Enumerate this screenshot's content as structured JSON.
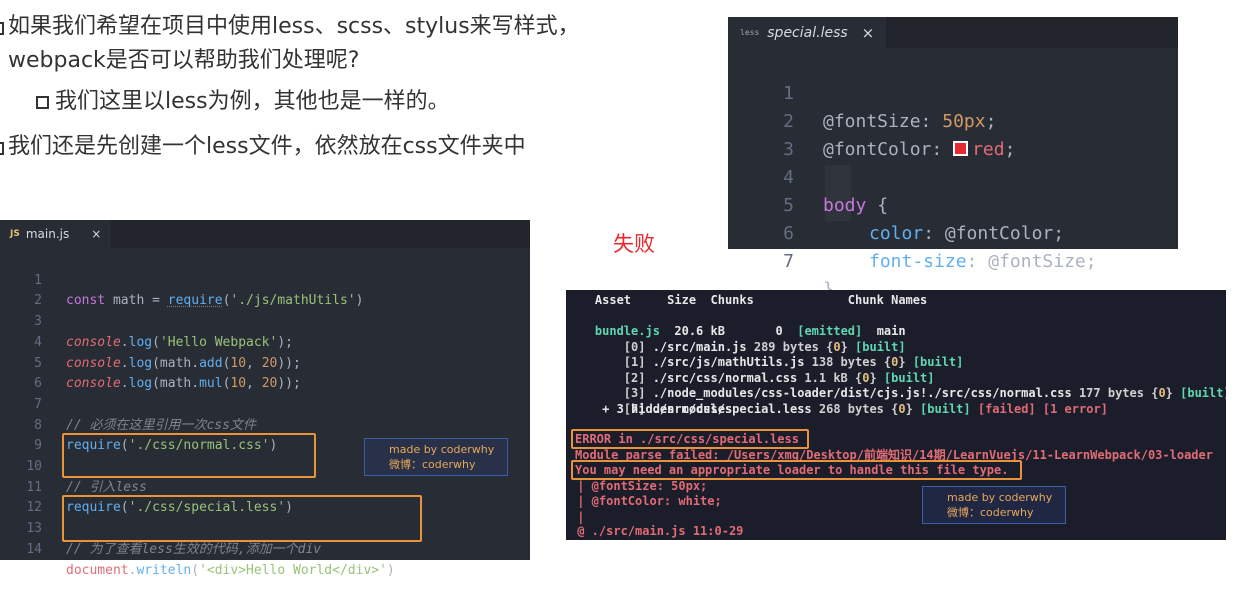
{
  "bullets": {
    "b1_line1": "如果我们希望在项目中使用less、scss、stylus来写样式，",
    "b1_line2": "webpack是否可以帮助我们处理呢?",
    "b2": "我们这里以less为例，其他也是一样的。",
    "b3": "我们还是先创建一个less文件，依然放在css文件夹中"
  },
  "fail_label": "失败",
  "colors": {
    "accent_red": "#e8292d",
    "box_orange": "#e8923a",
    "editor_bg": "#282c34",
    "terminal_bg": "#1c1d2b"
  },
  "less_editor": {
    "tab_icon": "less",
    "tab_label": "special.less",
    "tab_close": "×",
    "lines": [
      {
        "n": "1",
        "p1": "@fontSize",
        "p2": ": ",
        "p3": "50px",
        "p4": ";"
      },
      {
        "n": "2",
        "p1": "@fontColor",
        "p2": ": ",
        "p3": "red",
        "p4": ";"
      },
      {
        "n": "3"
      },
      {
        "n": "4",
        "p1": "body",
        "p2": " {"
      },
      {
        "n": "5",
        "p1": "color",
        "p2": ": ",
        "p3": "@fontColor",
        "p4": ";"
      },
      {
        "n": "6",
        "p1": "font-size",
        "p2": ": ",
        "p3": "@fontSize",
        "p4": ";"
      },
      {
        "n": "7",
        "p1": "}"
      }
    ]
  },
  "js_editor": {
    "tab_icon": "JS",
    "tab_label": "main.js",
    "tab_close": "×",
    "lines": [
      {
        "n": "1",
        "a": "const",
        "b": " math = ",
        "c": "require",
        "d": "(",
        "e": "'./js/mathUtils'",
        "f": ")"
      },
      {
        "n": "2"
      },
      {
        "n": "3",
        "a": "console",
        "b": ".",
        "c": "log",
        "d": "(",
        "e": "'Hello Webpack'",
        "f": ");"
      },
      {
        "n": "4",
        "a": "console",
        "b": ".",
        "c": "log",
        "d": "(math.",
        "e": "add",
        "f": "(",
        "g": "10",
        "h": ", ",
        "i": "20",
        "j": "));"
      },
      {
        "n": "5",
        "a": "console",
        "b": ".",
        "c": "log",
        "d": "(math.",
        "e": "mul",
        "f": "(",
        "g": "10",
        "h": ", ",
        "i": "20",
        "j": "));"
      },
      {
        "n": "6"
      },
      {
        "n": "7",
        "a": "// 必须在这里引用一次css文件"
      },
      {
        "n": "8",
        "a": "require",
        "b": "(",
        "c": "'./css/normal.css'",
        "d": ")"
      },
      {
        "n": "9"
      },
      {
        "n": "10",
        "a": "// 引入less"
      },
      {
        "n": "11",
        "a": "require",
        "b": "(",
        "c": "'./css/special.less'",
        "d": ")"
      },
      {
        "n": "12"
      },
      {
        "n": "13",
        "a": "// 为了查看less生效的代码,添加一个div"
      },
      {
        "n": "14",
        "a": "document",
        "b": ".",
        "c": "writeln",
        "d": "(",
        "e": "'<div>Hello World</div>'",
        "f": ")"
      }
    ]
  },
  "watermark": {
    "line1": "made by coderwhy",
    "line2": "微博：coderwhy"
  },
  "terminal": {
    "header": "    Asset     Size  Chunks             Chunk Names",
    "bundle_name": "bundle.js",
    "bundle_size": "  20.6 kB       0  ",
    "bundle_emitted": "[emitted]",
    "bundle_chunk": "  main",
    "mods": [
      {
        "id": "    [0] ",
        "path": "./src/main.js",
        "size": " 289 bytes {",
        "chunk": "0",
        "close": "} ",
        "status": "[built]"
      },
      {
        "id": "    [1] ",
        "path": "./src/js/mathUtils.js",
        "size": " 138 bytes {",
        "chunk": "0",
        "close": "} ",
        "status": "[built]"
      },
      {
        "id": "    [2] ",
        "path": "./src/css/normal.css",
        "size": " 1.1 kB {",
        "chunk": "0",
        "close": "} ",
        "status": "[built]"
      },
      {
        "id": "    [3] ",
        "path": "./node_modules/css-loader/dist/cjs.js!./src/css/normal.css",
        "size": " 177 bytes {",
        "chunk": "0",
        "close": "} ",
        "status": "[built]"
      },
      {
        "id": "    [7] ",
        "path": "./src/css/special.less",
        "size": " 268 bytes {",
        "chunk": "0",
        "close": "} ",
        "status": "[built]",
        "failed": " [failed] [1 error]"
      }
    ],
    "hidden": "     + 3 hidden modules",
    "error_title": "ERROR in ./src/css/special.less",
    "error_parse": "Module parse failed: /Users/xmg/Desktop/前端知识/14期/LearnVuejs/11-LearnWebpack/03-loader",
    "error_hint": "You may need an appropriate loader to handle this file type.",
    "snip1": " | @fontSize: 50px;",
    "snip2": " | @fontColor: white;",
    "snip3": " |",
    "at": " @ ./src/main.js 11:0-29"
  }
}
